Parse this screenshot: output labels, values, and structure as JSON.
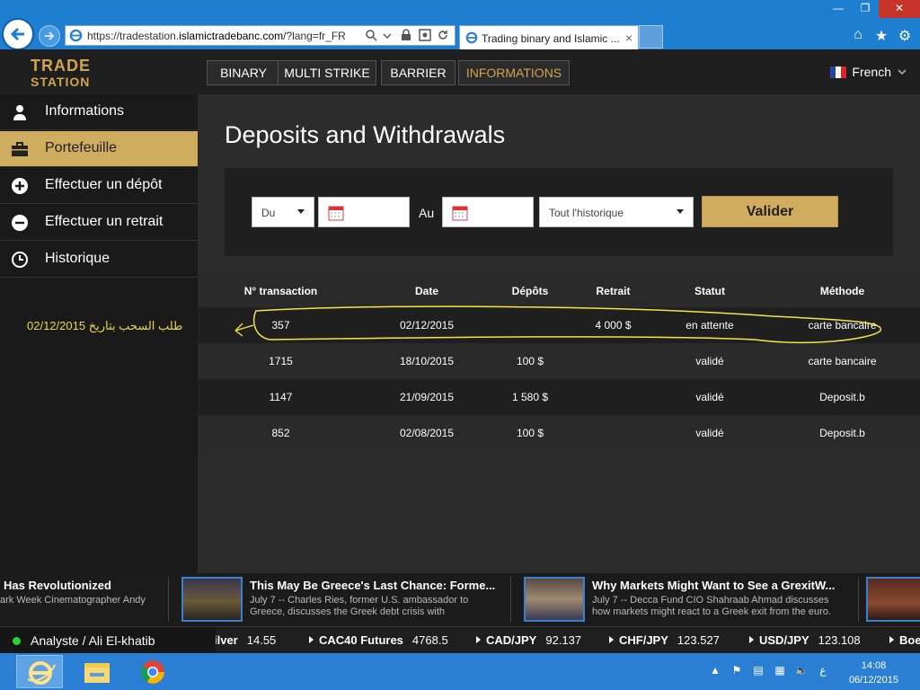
{
  "browser": {
    "url_prefix": "https://tradestation.",
    "url_domain": "islamictradebanc.com",
    "url_suffix": "/?lang=fr_FR",
    "tab_title": "Trading binary and Islamic ...",
    "tab_close": "×"
  },
  "logo": {
    "line1": "TRADE",
    "line2": "STATION"
  },
  "topnav": [
    "BINARY",
    "MULTI STRIKE",
    "BARRIER",
    "INFORMATIONS"
  ],
  "language": "French",
  "sidebar": {
    "items": [
      {
        "label": "Informations",
        "icon": "user-icon"
      },
      {
        "label": "Portefeuille",
        "icon": "briefcase-icon"
      },
      {
        "label": "Effectuer un dépôt",
        "icon": "plus-circle-icon"
      },
      {
        "label": "Effectuer un retrait",
        "icon": "minus-circle-icon"
      },
      {
        "label": "Historique",
        "icon": "clock-icon"
      }
    ],
    "annotation": "طلب السحب بتاريخ 02/12/2015"
  },
  "main": {
    "title": "Deposits and Withdrawals",
    "filter": {
      "from_select": "Du",
      "to_label": "Au",
      "history_select": "Tout l'historique",
      "validate": "Valider"
    },
    "table": {
      "headers": [
        "N° transaction",
        "Date",
        "Dépôts",
        "Retrait",
        "Statut",
        "Méthode"
      ],
      "rows": [
        [
          "357",
          "02/12/2015",
          "",
          "4 000 $",
          "en attente",
          "carte bancaire"
        ],
        [
          "1715",
          "18/10/2015",
          "100 $",
          "",
          "validé",
          "carte bancaire"
        ],
        [
          "1147",
          "21/09/2015",
          "1 580 $",
          "",
          "validé",
          "Deposit.b"
        ],
        [
          "852",
          "02/08/2015",
          "100 $",
          "",
          "validé",
          "Deposit.b"
        ]
      ]
    }
  },
  "news": [
    {
      "title": "Has Revolutionized",
      "desc1": "ark Week Cinematographer Andy",
      "desc2": ""
    },
    {
      "title": "This May Be Greece's Last Chance: Forme...",
      "desc1": "July 7 -- Charles Ries, former U.S. ambassador to",
      "desc2": "Greece, discusses the Greek debt crisis with"
    },
    {
      "title": "Why Markets Might Want to See a GrexitW...",
      "desc1": "July 7 -- Decca Fund CIO Shahraab Ahmad discusses",
      "desc2": "how markets might react to a Greek exit from the euro."
    }
  ],
  "status": {
    "text": "Analyste / Ali El-khatib"
  },
  "quotes": [
    {
      "name": "ilver",
      "value": "14.55",
      "arrow": false
    },
    {
      "name": "CAC40 Futures",
      "value": "4768.5",
      "arrow": true
    },
    {
      "name": "CAD/JPY",
      "value": "92.137",
      "arrow": true
    },
    {
      "name": "CHF/JPY",
      "value": "123.527",
      "arrow": true
    },
    {
      "name": "USD/JPY",
      "value": "123.108",
      "arrow": true
    },
    {
      "name": "Boe",
      "value": "",
      "arrow": true
    }
  ],
  "taskbar": {
    "time": "14:08",
    "date": "06/12/2015",
    "lang_glyph": "ع"
  },
  "colors": {
    "accent_gold": "#d0ac5e",
    "highlight_yellow": "#f0e64a",
    "status_green": "#29d13b"
  }
}
